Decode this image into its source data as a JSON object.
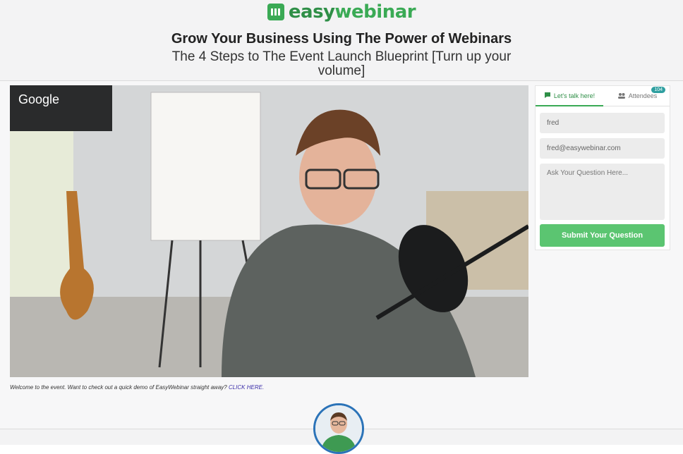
{
  "header": {
    "logo_easy": "easy",
    "logo_webinar": "webinar",
    "title": "Grow Your Business Using The Power of Webinars",
    "subtitle": "The 4 Steps to The Event Launch Blueprint [Turn up your volume]"
  },
  "video": {
    "overlay_label": "Google"
  },
  "caption": {
    "text": "Welcome to the event.  Want to check out a quick demo of EasyWebinar straight away? ",
    "link": "CLICK HERE."
  },
  "chat": {
    "tab_chat_label": "Let's talk here!",
    "tab_attendees_label": "Attendees",
    "attendees_count": "104",
    "name_value": "fred",
    "email_value": "fred@easywebinar.com",
    "question_placeholder": "Ask Your Question Here...",
    "submit_label": "Submit Your Question"
  },
  "icons": {
    "logo": "webinar-logo-icon",
    "chat": "chat-bubble-icon",
    "attendees": "people-icon"
  },
  "colors": {
    "brand_green": "#3aaa55",
    "brand_dark_green": "#2f8f47",
    "submit_green": "#5bc571",
    "badge_teal": "#2f9fa0",
    "avatar_ring": "#2b73b8"
  }
}
